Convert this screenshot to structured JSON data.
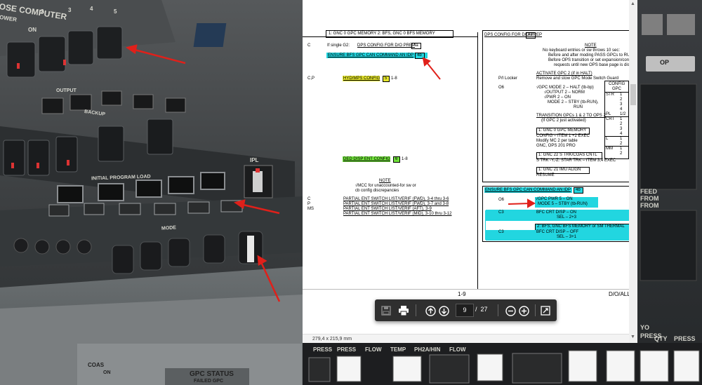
{
  "background": {
    "left_panel": {
      "computer_label": "OSE COMPUTER",
      "ower_label": "OWER",
      "on_label": "ON",
      "num_labels": [
        "2",
        "3",
        "4",
        "5"
      ],
      "output_label": "OUTPUT",
      "backup_label": "BACKUP",
      "ipl_label": "INITIAL PROGRAM LOAD",
      "ipl_button": "IPL",
      "mode_label": "MODE",
      "coas_label": "COAS",
      "coas_on": "ON",
      "gpc_status": "GPC STATUS",
      "failed_gpc": "FAILED GPC"
    },
    "right_panel": {
      "op_button": "OP",
      "feed_label": [
        "FEED",
        "FROM",
        "FROM"
      ],
      "press_labels": [
        "PRESS",
        "QTY",
        "PRESS"
      ],
      "yo_label": "YO"
    },
    "bottom_labels": [
      "PRESS",
      "PRESS",
      "FLOW",
      "TEMP",
      "PH2A/HIN",
      "FLOW"
    ]
  },
  "viewer": {
    "page_size": "279,4 x 215,9 mm",
    "toolbar": {
      "current_page": "9",
      "separator": "/",
      "total_pages": "27"
    },
    "icons": {
      "save": "save-icon",
      "print": "print-icon",
      "page_up": "page-up-icon",
      "page_down": "page-down-icon",
      "zoom_out": "zoom-out-icon",
      "zoom_in": "zoom-in-icon",
      "fit": "fit-page-icon"
    }
  },
  "doc": {
    "left_col": {
      "top_box": "1:  GNC 0 GPC MEMORY       2:  BFS, GNC 0 BFS MEMORY",
      "c_label": "C",
      "if_single": "If single G2:",
      "dps_config": "DPS CONFIG FOR D/O PREP",
      "dps_config_ref": "4a",
      "ensure_bfs": "ENSURE BFS GPC CAN COMMAND AN IDP",
      "ensure_bfs_ref": "4b",
      "cp_label": "C,P",
      "hyd_mps": "HYD/MPS CONFIG",
      "hyd_ref": "5",
      "hyd_page": "1-8",
      "ded_disp": "DED DISP ENT CONFIG",
      "ded_ref": "6",
      "ded_page": "1-8",
      "note_title": "NOTE",
      "note_line1": "√MCC for unaccounted-for sw or",
      "note_line2": "cb config discrepancies",
      "partial_labels": [
        "C",
        "P",
        "MS"
      ],
      "partial_items": [
        "PARTIAL ENT SWITCH LIST/VERIF (FWD), 3-4 thru 3-6",
        "PARTIAL ENT SWITCH LIST/VERIF (FWD), 3-7 and 3-8",
        "PARTIAL ENT SWITCH LIST/VERIF (AFT), 3-9",
        "PARTIAL ENT SWITCH LIST/VERIF (MID), 3-10 thru 3-12"
      ]
    },
    "right_col": {
      "dps_header": "DPS CONFIG FOR D/O PREP",
      "dps_header_ref": "4a",
      "note_title": "NOTE",
      "note_lines": [
        "No keyboard entries or sw throws 10 sec:",
        "Before and after moding PASS GPCs to RU",
        "Before OPS transition or set expansion/contr",
        "requests until new OPS base page is displ"
      ],
      "activate": "ACTIVATE GPC 2 (if in HALT)",
      "pl_locker": "P/I Locker",
      "remove_stow": "Remove and stow GPC Mode Switch Guard",
      "o6_label": "O6",
      "steps": [
        "√GPC MODE 2  – HALT (tb-bp)",
        "√OUTPUT 2 – NORM",
        "√PWR 2     – ON",
        "MODE 2     – STBY (tb-RUN),",
        "RUN"
      ],
      "transition": "TRANSITION GPCs 1 & 2 TO OPS 2",
      "if_gpc2": "(If GPC 2 just activated)",
      "gnc0_box": "1:  GNC 0 GPC MEMORY",
      "config_item": "CONFIG – ITEM 1 +2 EXEC",
      "modify_mc": "Modify MC 2 per table",
      "gnc_ops": "GNC, OPS 201 PRO",
      "gnc22_box": "1:  GNC 22 S TRK/COAS CNTL",
      "s_trk": "S TRK -Y,-Z:  STAR TRK – ITEM 3,4 EXEC",
      "gnc21_box": "1:  GNC 21 IMU ALIGN",
      "resume": "RESUME",
      "table_header": [
        "CONFIG",
        "GPC"
      ],
      "table_rows": [
        [
          "STR",
          "1"
        ],
        [
          "",
          "2"
        ],
        [
          "",
          "3"
        ],
        [
          "",
          "4"
        ],
        [
          "PL",
          "1/2"
        ],
        [
          "CRT",
          "1"
        ],
        [
          "",
          "2"
        ],
        [
          "",
          "3"
        ],
        [
          "",
          "4"
        ],
        [
          "L",
          "1"
        ],
        [
          "",
          "2"
        ],
        [
          "MM",
          "1"
        ],
        [
          "",
          "2"
        ]
      ],
      "ensure_box": "ENSURE BFS GPC CAN COMMAND AN IDP",
      "ensure_box_ref": "4b",
      "o6b": "O6",
      "gpc_pwr5": "√GPC PWR 5   – ON",
      "mode5": "MODE 5 – STBY (tb-RUN)",
      "c3a": "C3",
      "bfc_crt_on": "BFC CRT DISP – ON",
      "sel_on": "SEL  – 2+3",
      "bfs_gnc_box": "2:  BFS, GNC BFS MEMORY or SM THERMAL",
      "c3b": "C3",
      "bfc_crt_off": "BFC CRT DISP – OFF",
      "sel_off": "SEL  – 3+1"
    },
    "footer_page": "1-9",
    "footer_doc": "D/O/ALL"
  }
}
